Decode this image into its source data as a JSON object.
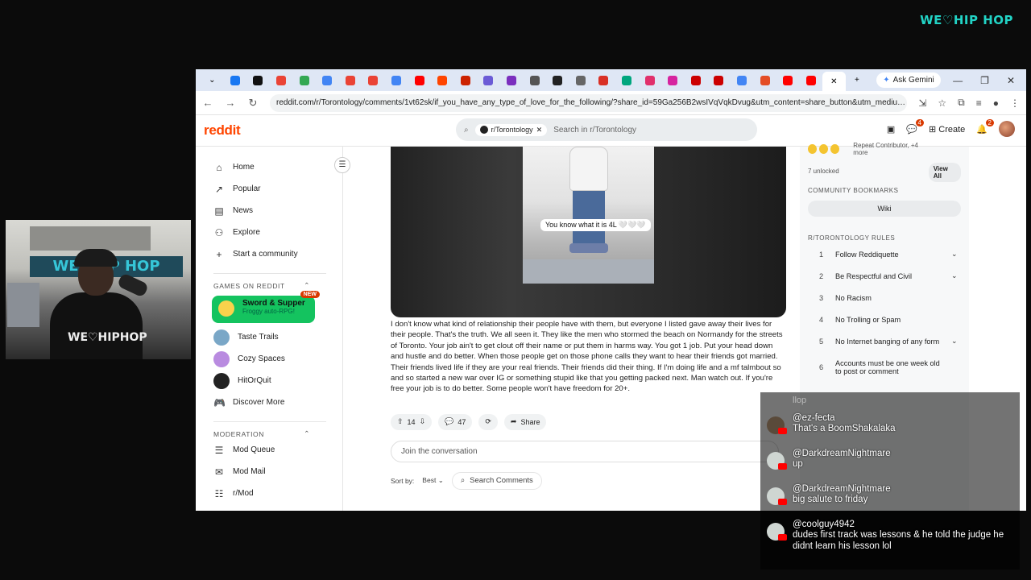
{
  "brand": "WE♡HIP HOP",
  "webcam": {
    "wall_sign": "WE♡HIP HOP",
    "shirt": "WE♡HIPHOP"
  },
  "browser": {
    "ask_gemini": "Ask Gemini",
    "url": "reddit.com/r/Torontology/comments/1vt62sk/if_you_have_any_type_of_love_for_the_following/?share_id=59Ga256B2wsIVqVqkDvug&utm_content=share_button&utm_medium=we...",
    "tab_colors": [
      "#1877f2",
      "#111111",
      "#ea4335",
      "#34a853",
      "#4285f4",
      "#ea4335",
      "#ea4335",
      "#4285f4",
      "#ff0000",
      "#ff4500",
      "#cc2200",
      "#6b5bd6",
      "#7b2fbe",
      "#555555",
      "#222222",
      "#666666",
      "#d93025",
      "#00a67e",
      "#e1306c",
      "#d6249f",
      "#cc0000",
      "#cc0000",
      "#4285f4",
      "#e44d26",
      "#ff0000",
      "#ff0000"
    ]
  },
  "reddit": {
    "logo": "reddit",
    "search_chip": "r/Torontology",
    "search_placeholder": "Search in r/Torontology",
    "create": "Create",
    "chat_count": "4",
    "notif_count": "2"
  },
  "sidebar": {
    "items": [
      {
        "icon": "home-icon",
        "label": "Home"
      },
      {
        "icon": "popular-icon",
        "label": "Popular"
      },
      {
        "icon": "news-icon",
        "label": "News"
      },
      {
        "icon": "explore-icon",
        "label": "Explore"
      },
      {
        "icon": "plus-icon",
        "label": "Start a community"
      }
    ],
    "games_heading": "GAMES ON REDDIT",
    "sword": {
      "title": "Sword & Supper",
      "subtitle": "Froggy auto-RPG!",
      "badge": "NEW"
    },
    "games": [
      {
        "label": "Taste Trails",
        "color": "#7aa7c7"
      },
      {
        "label": "Cozy Spaces",
        "color": "#b98be0"
      },
      {
        "label": "HitOrQuit",
        "color": "#222222"
      },
      {
        "label": "Discover More",
        "color": ""
      }
    ],
    "moderation_heading": "MODERATION",
    "mod_items": [
      "Mod Queue",
      "Mod Mail",
      "r/Mod"
    ]
  },
  "post": {
    "image_caption": "You know what it is 4L 🤍🤍🤍",
    "body": "I don't know what kind of relationship their people have with them, but everyone I listed gave away their lives for their people. That's the truth. We all seen it. They like the men who stormed the beach on Normandy for the streets of Toronto. Your job ain't to get clout off their name or put them in harms way. You got 1 job. Put your head down and hustle and do better. When those people get on those phone calls they want to hear their friends got married. Their friends lived life if they are your real friends. Their friends did their thing. If I'm doing life and a mf talmbout so and so started a new war over IG or something stupid like that you getting packed next. Man watch out. If you're free your job is to do better. Some people won't have freedom for 20+.",
    "votes": "14",
    "comments": "47",
    "share": "Share",
    "join": "Join the conversation",
    "sort_by": "Sort by:",
    "sort_value": "Best",
    "search_comments": "Search Comments"
  },
  "right": {
    "repeat": "Repeat Contributor, +4 more",
    "unlocked": "7 unlocked",
    "view_all": "View All",
    "bookmarks_heading": "COMMUNITY BOOKMARKS",
    "wiki": "Wiki",
    "rules_heading": "R/TORONTOLOGY RULES",
    "rules": [
      {
        "n": "1",
        "text": "Follow Reddiquette",
        "chev": "⌄"
      },
      {
        "n": "2",
        "text": "Be Respectful and Civil",
        "chev": "⌄"
      },
      {
        "n": "3",
        "text": "No Racism",
        "chev": ""
      },
      {
        "n": "4",
        "text": "No Trolling or Spam",
        "chev": ""
      },
      {
        "n": "5",
        "text": "No Internet banging of any form",
        "chev": "⌄"
      },
      {
        "n": "6",
        "text": "Accounts must be one week old to post or comment",
        "chev": ""
      }
    ]
  },
  "chat": {
    "bg_text": "llop",
    "messages": [
      {
        "user": "@ez-fecta",
        "text": "That's a BoomShakalaka"
      },
      {
        "user": "@DarkdreamNightmare",
        "text": "up"
      },
      {
        "user": "@DarkdreamNightmare",
        "text": "big salute to friday"
      },
      {
        "user": "@coolguy4942",
        "text": "dudes first track was lessons & he told the judge he didnt learn his lesson lol"
      }
    ]
  }
}
